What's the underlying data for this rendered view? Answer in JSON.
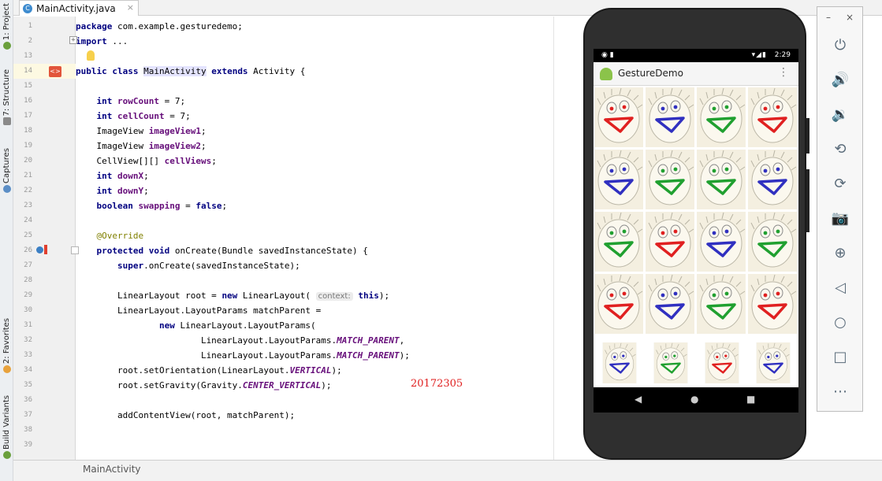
{
  "left_strip": {
    "tabs": [
      "1: Project",
      "7: Structure",
      "Captures",
      "2: Favorites",
      "Build Variants"
    ]
  },
  "tab_bar": {
    "tab_label": "MainActivity.java",
    "tab_icon_letter": "C",
    "close_glyph": "×"
  },
  "editor": {
    "lines": [
      {
        "n": "1",
        "parts": [
          [
            "kw",
            "package"
          ],
          [
            "",
            " com.example.gesturedemo;"
          ]
        ]
      },
      {
        "n": "2",
        "parts": [
          [
            "kw",
            "import"
          ],
          [
            "",
            " ..."
          ]
        ]
      },
      {
        "n": "13",
        "parts": []
      },
      {
        "n": "14",
        "parts": [
          [
            "kw",
            "public class "
          ],
          [
            "cls-hl",
            "MainActivity"
          ],
          [
            "kw",
            " extends"
          ],
          [
            "",
            " Activity {"
          ]
        ]
      },
      {
        "n": "15",
        "parts": []
      },
      {
        "n": "16",
        "parts": [
          [
            "",
            "    "
          ],
          [
            "kw",
            "int"
          ],
          [
            "",
            " "
          ],
          [
            "fld",
            "rowCount"
          ],
          [
            "",
            " = 7;"
          ]
        ]
      },
      {
        "n": "17",
        "parts": [
          [
            "",
            "    "
          ],
          [
            "kw",
            "int"
          ],
          [
            "",
            " "
          ],
          [
            "fld",
            "cellCount"
          ],
          [
            "",
            " = 7;"
          ]
        ]
      },
      {
        "n": "18",
        "parts": [
          [
            "",
            "    ImageView "
          ],
          [
            "fld",
            "imageView1"
          ],
          [
            "",
            ";"
          ]
        ]
      },
      {
        "n": "19",
        "parts": [
          [
            "",
            "    ImageView "
          ],
          [
            "fld",
            "imageView2"
          ],
          [
            "",
            ";"
          ]
        ]
      },
      {
        "n": "20",
        "parts": [
          [
            "",
            "    CellView[][] "
          ],
          [
            "fld",
            "cellViews"
          ],
          [
            "",
            ";"
          ]
        ]
      },
      {
        "n": "21",
        "parts": [
          [
            "",
            "    "
          ],
          [
            "kw",
            "int"
          ],
          [
            "",
            " "
          ],
          [
            "fld",
            "downX"
          ],
          [
            "",
            ";"
          ]
        ]
      },
      {
        "n": "22",
        "parts": [
          [
            "",
            "    "
          ],
          [
            "kw",
            "int"
          ],
          [
            "",
            " "
          ],
          [
            "fld",
            "downY"
          ],
          [
            "",
            ";"
          ]
        ]
      },
      {
        "n": "23",
        "parts": [
          [
            "",
            "    "
          ],
          [
            "kw",
            "boolean"
          ],
          [
            "",
            " "
          ],
          [
            "fld",
            "swapping"
          ],
          [
            "",
            " = "
          ],
          [
            "kw",
            "false"
          ],
          [
            "",
            ";"
          ]
        ]
      },
      {
        "n": "24",
        "parts": []
      },
      {
        "n": "25",
        "parts": [
          [
            "",
            "    "
          ],
          [
            "ann",
            "@Override"
          ]
        ]
      },
      {
        "n": "26",
        "parts": [
          [
            "",
            "    "
          ],
          [
            "kw",
            "protected void"
          ],
          [
            "",
            " onCreate(Bundle savedInstanceState) {"
          ]
        ]
      },
      {
        "n": "27",
        "parts": [
          [
            "",
            "        "
          ],
          [
            "kw",
            "super"
          ],
          [
            "",
            ".onCreate(savedInstanceState);"
          ]
        ]
      },
      {
        "n": "28",
        "parts": []
      },
      {
        "n": "29",
        "parts": [
          [
            "",
            "        LinearLayout root = "
          ],
          [
            "kw",
            "new"
          ],
          [
            "",
            " LinearLayout( "
          ],
          [
            "hint",
            "context:"
          ],
          [
            "",
            " "
          ],
          [
            "kw",
            "this"
          ],
          [
            "",
            ");"
          ]
        ]
      },
      {
        "n": "30",
        "parts": [
          [
            "",
            "        LinearLayout.LayoutParams matchParent ="
          ]
        ]
      },
      {
        "n": "31",
        "parts": [
          [
            "",
            "                "
          ],
          [
            "kw",
            "new"
          ],
          [
            "",
            " LinearLayout.LayoutParams("
          ]
        ]
      },
      {
        "n": "32",
        "parts": [
          [
            "",
            "                        LinearLayout.LayoutParams."
          ],
          [
            "st",
            "MATCH_PARENT"
          ],
          [
            "",
            ","
          ]
        ]
      },
      {
        "n": "33",
        "parts": [
          [
            "",
            "                        LinearLayout.LayoutParams."
          ],
          [
            "st",
            "MATCH_PARENT"
          ],
          [
            "",
            ");"
          ]
        ]
      },
      {
        "n": "34",
        "parts": [
          [
            "",
            "        root.setOrientation(LinearLayout."
          ],
          [
            "st",
            "VERTICAL"
          ],
          [
            "",
            ");"
          ]
        ]
      },
      {
        "n": "35",
        "parts": [
          [
            "",
            "        root.setGravity(Gravity."
          ],
          [
            "st",
            "CENTER_VERTICAL"
          ],
          [
            "",
            ");"
          ]
        ]
      },
      {
        "n": "36",
        "parts": []
      },
      {
        "n": "37",
        "parts": [
          [
            "",
            "        addContentView(root, matchParent);"
          ]
        ]
      },
      {
        "n": "38",
        "parts": []
      },
      {
        "n": "39",
        "parts": []
      }
    ],
    "watermark": "20172305"
  },
  "status_bar": {
    "breadcrumb": "MainActivity"
  },
  "emulator": {
    "status_time": "2:29",
    "app_title": "GestureDemo",
    "overflow_glyph": "⋮",
    "mouth_colors": [
      [
        "#e02020",
        "#3030c0",
        "#20a030",
        "#e02020"
      ],
      [
        "#3030c0",
        "#20a030",
        "#20a030",
        "#3030c0"
      ],
      [
        "#20a030",
        "#e02020",
        "#3030c0",
        "#20a030"
      ],
      [
        "#e02020",
        "#3030c0",
        "#20a030",
        "#e02020"
      ],
      [
        "#3030c0",
        "#20a030",
        "#e02020",
        "#3030c0"
      ]
    ],
    "nav": {
      "back": "◀",
      "home": "●",
      "recents": "■"
    }
  },
  "emu_toolbar": {
    "minimize": "–",
    "close": "×",
    "icons": [
      {
        "name": "power-icon",
        "glyph": "⏻"
      },
      {
        "name": "volume-up-icon",
        "glyph": "🔊"
      },
      {
        "name": "volume-down-icon",
        "glyph": "🔉"
      },
      {
        "name": "rotate-left-icon",
        "glyph": "⟲"
      },
      {
        "name": "rotate-right-icon",
        "glyph": "⟳"
      },
      {
        "name": "camera-icon",
        "glyph": "📷"
      },
      {
        "name": "zoom-icon",
        "glyph": "⊕"
      },
      {
        "name": "back-icon",
        "glyph": "◁"
      },
      {
        "name": "home-icon",
        "glyph": "○"
      },
      {
        "name": "overview-icon",
        "glyph": "□"
      },
      {
        "name": "more-icon",
        "glyph": "⋯"
      }
    ]
  }
}
